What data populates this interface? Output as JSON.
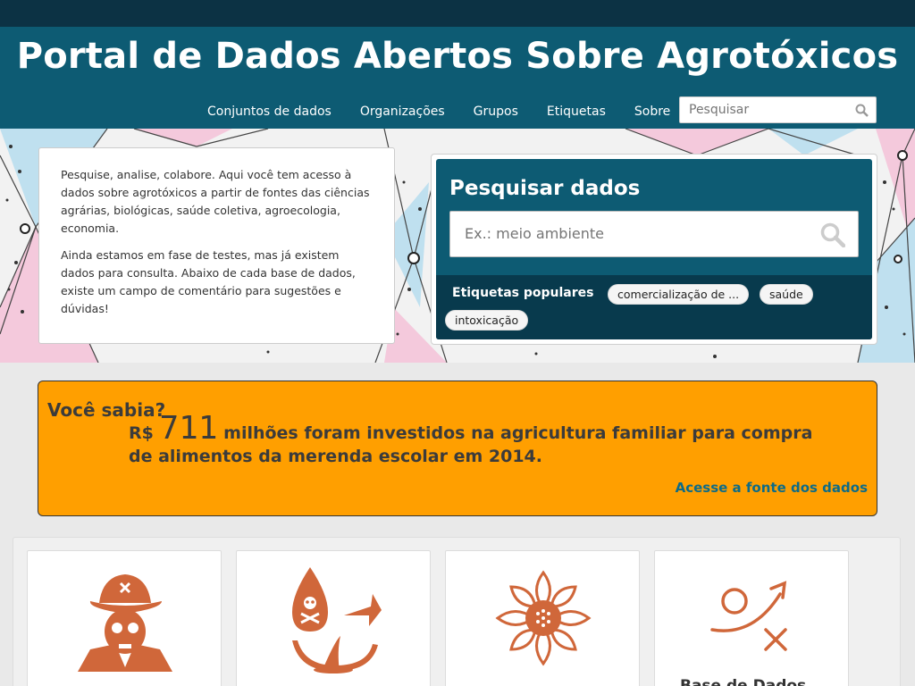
{
  "header": {
    "title": "Portal de Dados Abertos Sobre Agrotóxicos",
    "nav": [
      "Conjuntos de dados",
      "Organizações",
      "Grupos",
      "Etiquetas",
      "Sobre"
    ],
    "search_placeholder": "Pesquisar"
  },
  "intro": {
    "paragraph1": "Pesquise, analise, colabore. Aqui você tem acesso à dados sobre agrotóxicos a partir de fontes das ciências agrárias, biológicas, saúde coletiva, agroecologia, economia.",
    "paragraph2": "Ainda estamos em fase de testes, mas já existem dados para consulta. Abaixo de cada base de dados, existe um campo de comentário para sugestões e dúvidas!"
  },
  "search_panel": {
    "title": "Pesquisar dados",
    "placeholder": "Ex.: meio ambiente",
    "tags_label": "Etiquetas populares",
    "tags": [
      "comercialização de ...",
      "saúde",
      "intoxicação"
    ]
  },
  "fact": {
    "title": "Você sabia?",
    "currency": "R$",
    "amount": "711",
    "text_line1": "milhões foram investidos na agricultura familiar para compra",
    "text_line2": "de alimentos da merenda escolar em 2014.",
    "link": "Acesse a fonte dos dados"
  },
  "cards": [
    {
      "icon": "skull-farmer-icon",
      "label": ""
    },
    {
      "icon": "poison-drop-plant-icon",
      "label": ""
    },
    {
      "icon": "mandala-flower-icon",
      "label": ""
    },
    {
      "icon": "strategy-play-icon",
      "label": "Base de Dados"
    }
  ],
  "colors": {
    "header": "#0d5b73",
    "topbar": "#0c3244",
    "fact_bg": "#ff9f00",
    "icon": "#d0673a",
    "link": "#0d6b87"
  }
}
